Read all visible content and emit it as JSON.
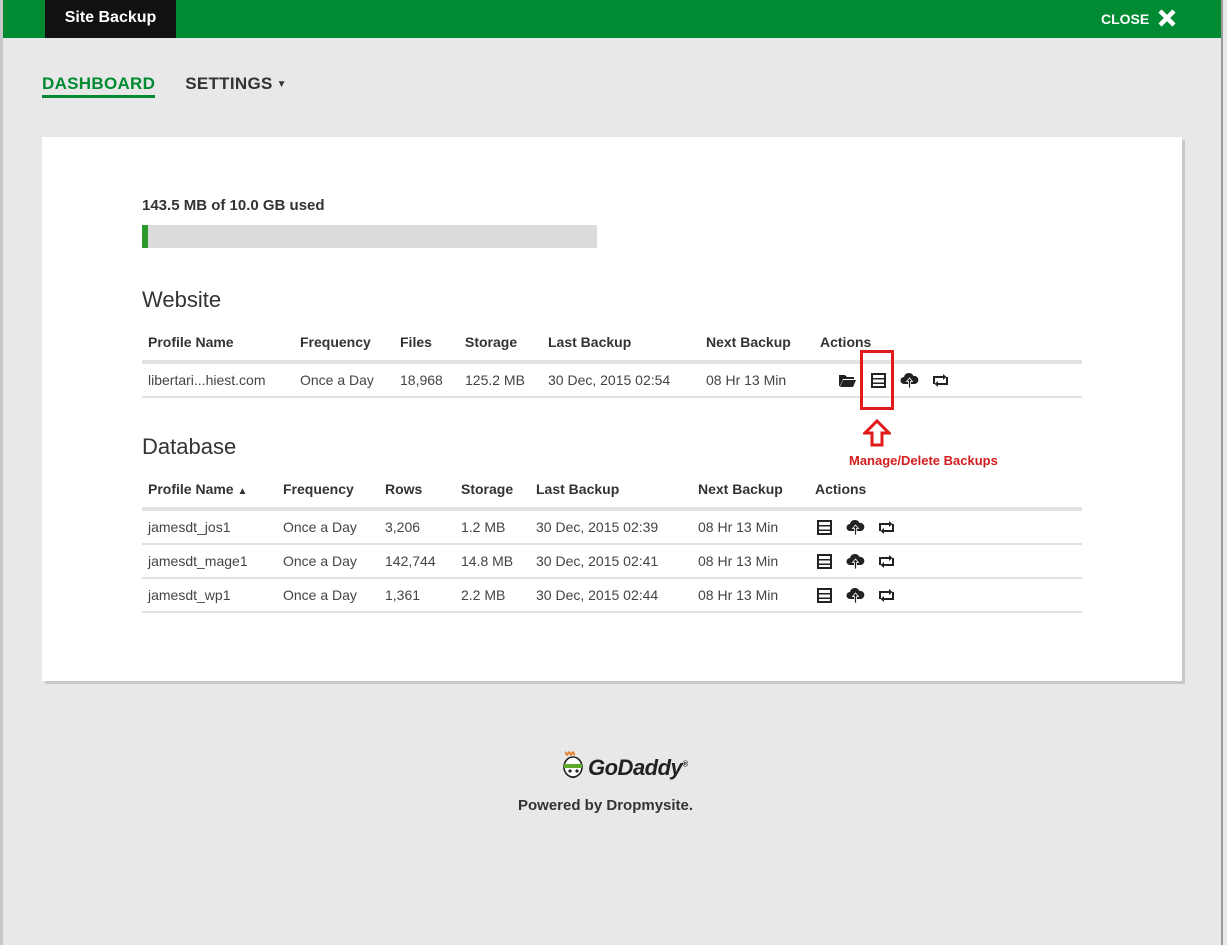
{
  "window": {
    "tab_title": "Site Backup",
    "close_label": "CLOSE"
  },
  "nav": {
    "dashboard": "DASHBOARD",
    "settings": "SETTINGS"
  },
  "usage": {
    "text": "143.5 MB of 10.0 GB used",
    "fraction": 0.014
  },
  "website": {
    "title": "Website",
    "headers": [
      "Profile Name",
      "Frequency",
      "Files",
      "Storage",
      "Last Backup",
      "Next Backup",
      "Actions"
    ],
    "rows": [
      {
        "name": "libertari...hiest.com",
        "frequency": "Once a Day",
        "files": "18,968",
        "storage": "125.2 MB",
        "last": "30 Dec, 2015 02:54",
        "next": "08 Hr 13 Min"
      }
    ],
    "actions": [
      "folder-open-icon",
      "server-icon",
      "cloud-upload-icon",
      "retweet-icon"
    ]
  },
  "database": {
    "title": "Database",
    "headers": [
      "Profile Name",
      "Frequency",
      "Rows",
      "Storage",
      "Last Backup",
      "Next Backup",
      "Actions"
    ],
    "sort_indicator": "▲",
    "rows": [
      {
        "name": "jamesdt_jos1",
        "frequency": "Once a Day",
        "rows": "3,206",
        "storage": "1.2 MB",
        "last": "30 Dec, 2015 02:39",
        "next": "08 Hr 13 Min"
      },
      {
        "name": "jamesdt_mage1",
        "frequency": "Once a Day",
        "rows": "142,744",
        "storage": "14.8 MB",
        "last": "30 Dec, 2015 02:41",
        "next": "08 Hr 13 Min"
      },
      {
        "name": "jamesdt_wp1",
        "frequency": "Once a Day",
        "rows": "1,361",
        "storage": "2.2 MB",
        "last": "30 Dec, 2015 02:44",
        "next": "08 Hr 13 Min"
      }
    ],
    "actions": [
      "server-icon",
      "cloud-upload-icon",
      "retweet-icon"
    ]
  },
  "annotation": {
    "text": "Manage/Delete Backups",
    "color": "#d31d1d"
  },
  "footer": {
    "logo_text": "GoDaddy",
    "powered_by": "Powered by Dropmysite."
  },
  "colors": {
    "brand_green": "#008a32",
    "dark_tab": "#111111",
    "usage_fill": "#2a9b2a"
  }
}
